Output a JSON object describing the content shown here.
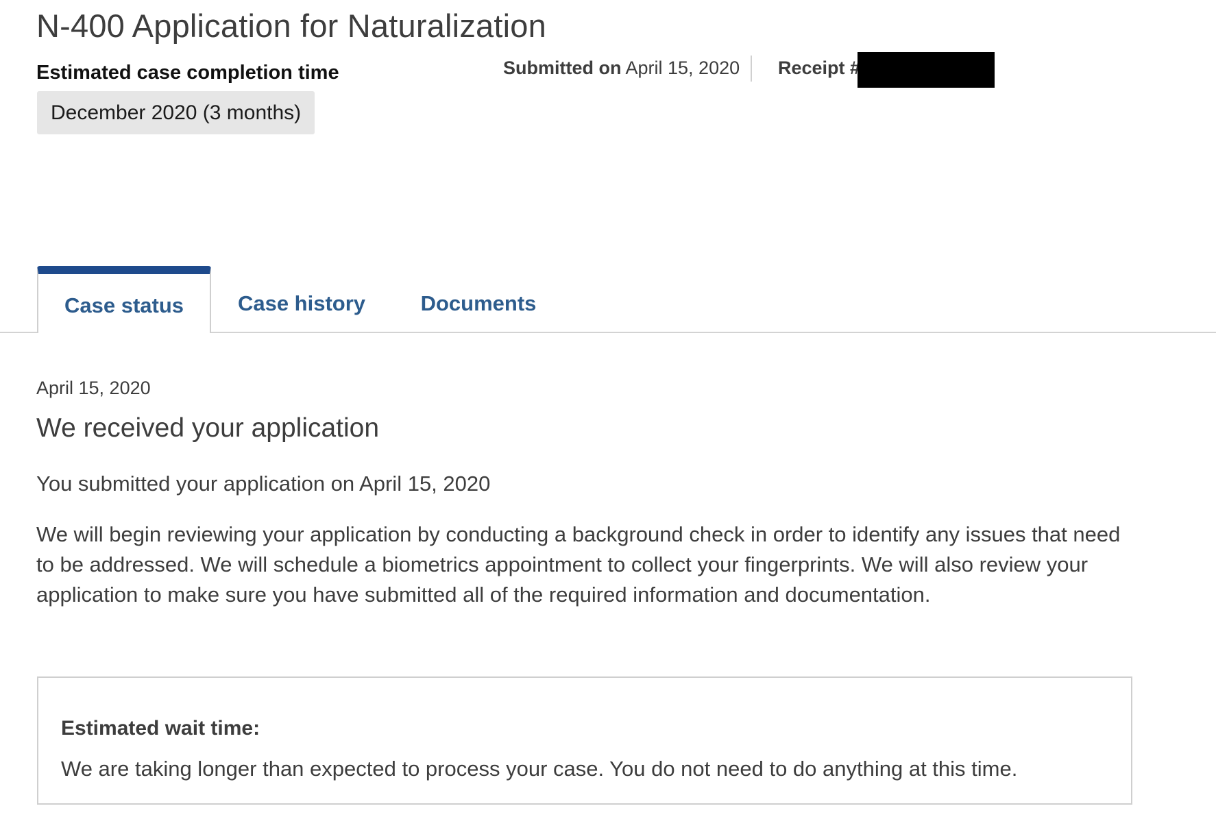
{
  "header": {
    "title": "N-400 Application for Naturalization",
    "completion_label": "Estimated case completion time",
    "completion_value": "December 2020 (3 months)",
    "submitted_label": "Submitted on",
    "submitted_date": "April 15, 2020",
    "receipt_label": "Receipt #"
  },
  "tabs": [
    {
      "label": "Case status",
      "active": true
    },
    {
      "label": "Case history",
      "active": false
    },
    {
      "label": "Documents",
      "active": false
    }
  ],
  "status": {
    "date": "April 15, 2020",
    "heading": "We received your application",
    "submitted_line": "You submitted your application on April 15, 2020",
    "body": "We will begin reviewing your application by conducting a background check in order to identify any issues that need to be addressed. We will schedule a biometrics appointment to collect your fingerprints. We will also review your application to make sure you have submitted all of the required information and documentation."
  },
  "wait": {
    "title": "Estimated wait time:",
    "text": "We are taking longer than expected to process your case. You do not need to do anything at this time."
  },
  "colors": {
    "tab_active_bar": "#1e4a8c",
    "tab_text": "#2d5c8d",
    "completion_bg": "#e6e6e6",
    "redaction": "#000000"
  }
}
